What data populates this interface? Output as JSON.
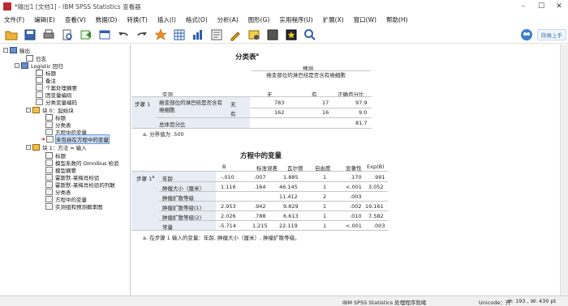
{
  "window": {
    "title": "*输出1 [文档1] - IBM SPSS Statistics 查看器",
    "controls": [
      "–",
      "☐",
      "✕"
    ]
  },
  "menu": [
    "文件(F)",
    "编辑(E)",
    "查看(V)",
    "数据(D)",
    "转换(T)",
    "插入(I)",
    "格式(O)",
    "分析(A)",
    "图形(G)",
    "实用程序(U)",
    "扩展(X)",
    "窗口(W)",
    "帮助(H)"
  ],
  "toolbar": {
    "icons": [
      "open-folder-icon",
      "save-icon",
      "print-icon",
      "print-preview-icon",
      "export-icon",
      "recall-dialog-icon",
      "undo-icon",
      "redo-icon",
      "goto-data-icon",
      "goto-case-icon",
      "goto-variable-icon",
      "insert-heading-icon",
      "insert-title-icon",
      "insert-text-icon",
      "hide-icon",
      "designate-window-icon",
      "search-icon"
    ],
    "right_chip": "陈格上手"
  },
  "tree": [
    {
      "label": "输出",
      "level": 0,
      "exp": "-",
      "icon": "book"
    },
    {
      "label": "日志",
      "level": 2,
      "exp": "",
      "icon": "log"
    },
    {
      "label": "Logistic 回归",
      "level": 1,
      "exp": "-",
      "icon": "book"
    },
    {
      "label": "标题",
      "level": 2,
      "exp": "",
      "icon": "log"
    },
    {
      "label": "备注",
      "level": 2,
      "exp": "",
      "icon": "log"
    },
    {
      "label": "个案处理摘要",
      "level": 2,
      "exp": "",
      "icon": "tbl"
    },
    {
      "label": "因变量编码",
      "level": 2,
      "exp": "",
      "icon": "tbl"
    },
    {
      "label": "分类变量编码",
      "level": 2,
      "exp": "",
      "icon": "tbl"
    },
    {
      "label": "块 0：起始块",
      "level": 2,
      "exp": "-",
      "icon": "blk"
    },
    {
      "label": "标题",
      "level": 3,
      "exp": "",
      "icon": "log"
    },
    {
      "label": "分类表",
      "level": 3,
      "exp": "",
      "icon": "tbl"
    },
    {
      "label": "方程中的变量",
      "level": 3,
      "exp": "",
      "icon": "tbl"
    },
    {
      "label": "未包括在方程中的变量",
      "level": 3,
      "exp": "",
      "icon": "tbl",
      "selected": true
    },
    {
      "label": "块 1：方法 = 输入",
      "level": 2,
      "exp": "-",
      "icon": "blk"
    },
    {
      "label": "标题",
      "level": 3,
      "exp": "",
      "icon": "log"
    },
    {
      "label": "模型系数的 Omnibus 检验",
      "level": 3,
      "exp": "",
      "icon": "tbl"
    },
    {
      "label": "模型摘要",
      "level": 3,
      "exp": "",
      "icon": "tbl"
    },
    {
      "label": "霍斯默-莱梅肖检验",
      "level": 3,
      "exp": "",
      "icon": "tbl"
    },
    {
      "label": "霍斯默-莱梅肖检验的列联",
      "level": 3,
      "exp": "",
      "icon": "tbl"
    },
    {
      "label": "分类表",
      "level": 3,
      "exp": "",
      "icon": "tbl"
    },
    {
      "label": "方程中的变量",
      "level": 3,
      "exp": "",
      "icon": "tbl"
    },
    {
      "label": "实测组和预测概率图",
      "level": 3,
      "exp": "",
      "icon": "tbl"
    }
  ],
  "classification_table": {
    "title": "分类表",
    "title_sup": "a",
    "header_predicted": "预测",
    "header_group": "癌变部位的淋巴结是否含有癌细胞",
    "header_actual": "实测",
    "col_no": "无",
    "col_yes": "有",
    "col_pct": "正确百分比",
    "step": "步骤 1",
    "row_var": "癌变部位的淋巴结是否含有癌细胞",
    "rows": [
      {
        "label": "无",
        "no": "783",
        "yes": "17",
        "pct": "97.9"
      },
      {
        "label": "有",
        "no": "162",
        "yes": "16",
        "pct": "9.0"
      }
    ],
    "overall_label": "总体百分比",
    "overall_pct": "81.7",
    "footnote": "a. 分界值为 .500"
  },
  "variables_table": {
    "title": "方程中的变量",
    "headers": [
      "B",
      "标准误差",
      "瓦尔德",
      "自由度",
      "显著性",
      "Exp(B)"
    ],
    "step": "步骤 1",
    "step_sup": "a",
    "rows": [
      {
        "label": "年龄",
        "values": [
          "-.010",
          ".007",
          "1.885",
          "1",
          ".170",
          ".991"
        ]
      },
      {
        "label": "肿瘤大小（厘米）",
        "values": [
          "1.116",
          ".164",
          "46.145",
          "1",
          "<.001",
          "3.052"
        ]
      },
      {
        "label": "肿瘤扩散等级",
        "values": [
          "",
          "",
          "11.412",
          "2",
          ".003",
          ""
        ]
      },
      {
        "label": "肿瘤扩散等级(1)",
        "values": [
          "2.953",
          ".942",
          "9.829",
          "1",
          ".002",
          "19.161"
        ]
      },
      {
        "label": "肿瘤扩散等级(2)",
        "values": [
          "2.026",
          ".788",
          "6.613",
          "1",
          ".010",
          "7.582"
        ]
      },
      {
        "label": "常量",
        "values": [
          "-5.714",
          "1.215",
          "22.119",
          "1",
          "<.001",
          ".003"
        ]
      }
    ],
    "footnote": "a. 在步骤 1 输入的变量：年龄, 肿瘤大小（厘米）, 肿瘤扩散等级。"
  },
  "status": {
    "processor": "IBM SPSS Statistics 处理程序就绪",
    "unicode": "Unicode：开",
    "dims": "H: 193 , W: 430 pt"
  },
  "colors": {
    "band": "#e8ecf4",
    "accent": "#2e4e86"
  }
}
